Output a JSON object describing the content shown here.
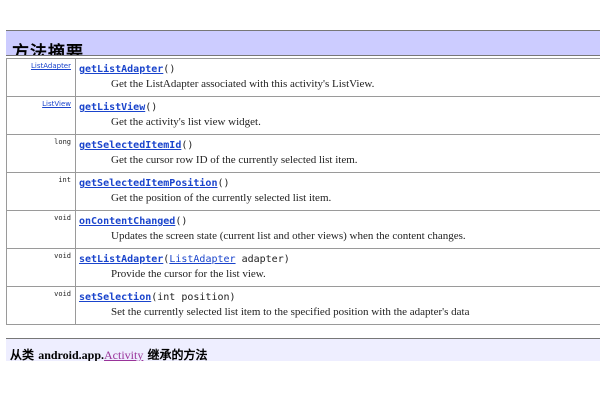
{
  "header": {
    "title": "方法摘要"
  },
  "methods": [
    {
      "return_type": "ListAdapter",
      "return_is_link": true,
      "name": "getListAdapter",
      "params_pre": "()",
      "param_link": "",
      "params_post": "",
      "description": "Get the ListAdapter associated with this activity's ListView."
    },
    {
      "return_type": "ListView",
      "return_is_link": true,
      "name": "getListView",
      "params_pre": "()",
      "param_link": "",
      "params_post": "",
      "description": "Get the activity's list view widget."
    },
    {
      "return_type": "long",
      "return_is_link": false,
      "name": "getSelectedItemId",
      "params_pre": "()",
      "param_link": "",
      "params_post": "",
      "description": "Get the cursor row ID of the currently selected list item."
    },
    {
      "return_type": "int",
      "return_is_link": false,
      "name": "getSelectedItemPosition",
      "params_pre": "()",
      "param_link": "",
      "params_post": "",
      "description": "Get the position of the currently selected list item."
    },
    {
      "return_type": "void",
      "return_is_link": false,
      "name": "onContentChanged",
      "params_pre": "()",
      "param_link": "",
      "params_post": "",
      "description": "Updates the screen state (current list and other views) when the content changes."
    },
    {
      "return_type": "void",
      "return_is_link": false,
      "name": "setListAdapter",
      "params_pre": "(",
      "param_link": "ListAdapter",
      "params_post": " adapter)",
      "description": "Provide the cursor for the list view."
    },
    {
      "return_type": "void",
      "return_is_link": false,
      "name": "setSelection",
      "params_pre": "(int position)",
      "param_link": "",
      "params_post": "",
      "description": "Set the currently selected list item to the specified position with the adapter's data"
    }
  ],
  "inherited": {
    "prefix": "从类",
    "package": "android.app.",
    "class_name": "Activity",
    "suffix": "继承的方法"
  },
  "colors": {
    "header_bg": "#ccccff",
    "link": "#1a44cc",
    "inherited_class": "#993399"
  }
}
